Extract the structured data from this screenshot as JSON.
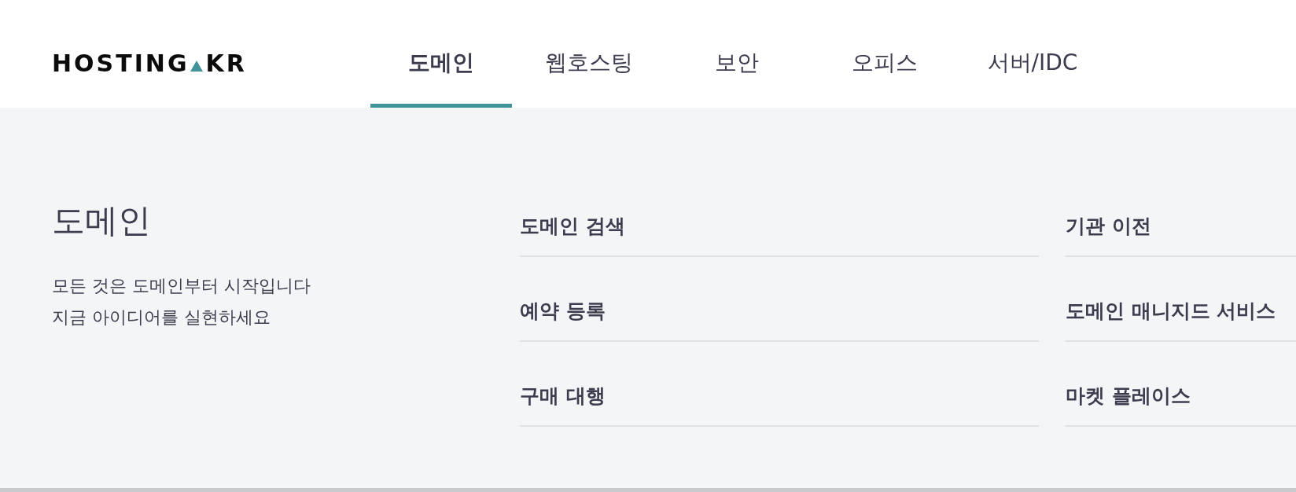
{
  "logo": {
    "text_before": "HOSTING",
    "text_after": "KR"
  },
  "nav_tabs": [
    {
      "label": "도메인",
      "selected": true
    },
    {
      "label": "웹호스팅",
      "selected": false
    },
    {
      "label": "보안",
      "selected": false
    },
    {
      "label": "오피스",
      "selected": false
    },
    {
      "label": "서버/IDC",
      "selected": false
    }
  ],
  "panel": {
    "title": "도메인",
    "description_lines": [
      "모든 것은 도메인부터 시작입니다",
      "지금 아이디어를 실현하세요"
    ]
  },
  "menu_columns": [
    [
      "도메인 검색",
      "예약 등록",
      "구매 대행"
    ],
    [
      "기관 이전",
      "도메인 매니지드 서비스",
      "마켓 플레이스"
    ]
  ]
}
